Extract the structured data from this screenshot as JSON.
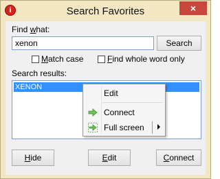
{
  "window": {
    "title": "Search Favorites",
    "close_label": "×"
  },
  "find": {
    "label_pre": "Find ",
    "label_ul": "w",
    "label_post": "hat:",
    "value": "xenon",
    "search_button": "Search"
  },
  "options": {
    "match_case_ul": "M",
    "match_case_rest": "atch case",
    "whole_word_ul": "F",
    "whole_word_rest": "ind whole word only"
  },
  "results": {
    "label": "Search results:",
    "items": [
      "XENON"
    ]
  },
  "context_menu": {
    "edit": "Edit",
    "connect": "Connect",
    "full_screen": "Full screen"
  },
  "buttons": {
    "hide_ul": "H",
    "hide_rest": "ide",
    "edit_ul": "E",
    "edit_rest": "dit",
    "connect_ul": "C",
    "connect_rest": "onnect"
  }
}
